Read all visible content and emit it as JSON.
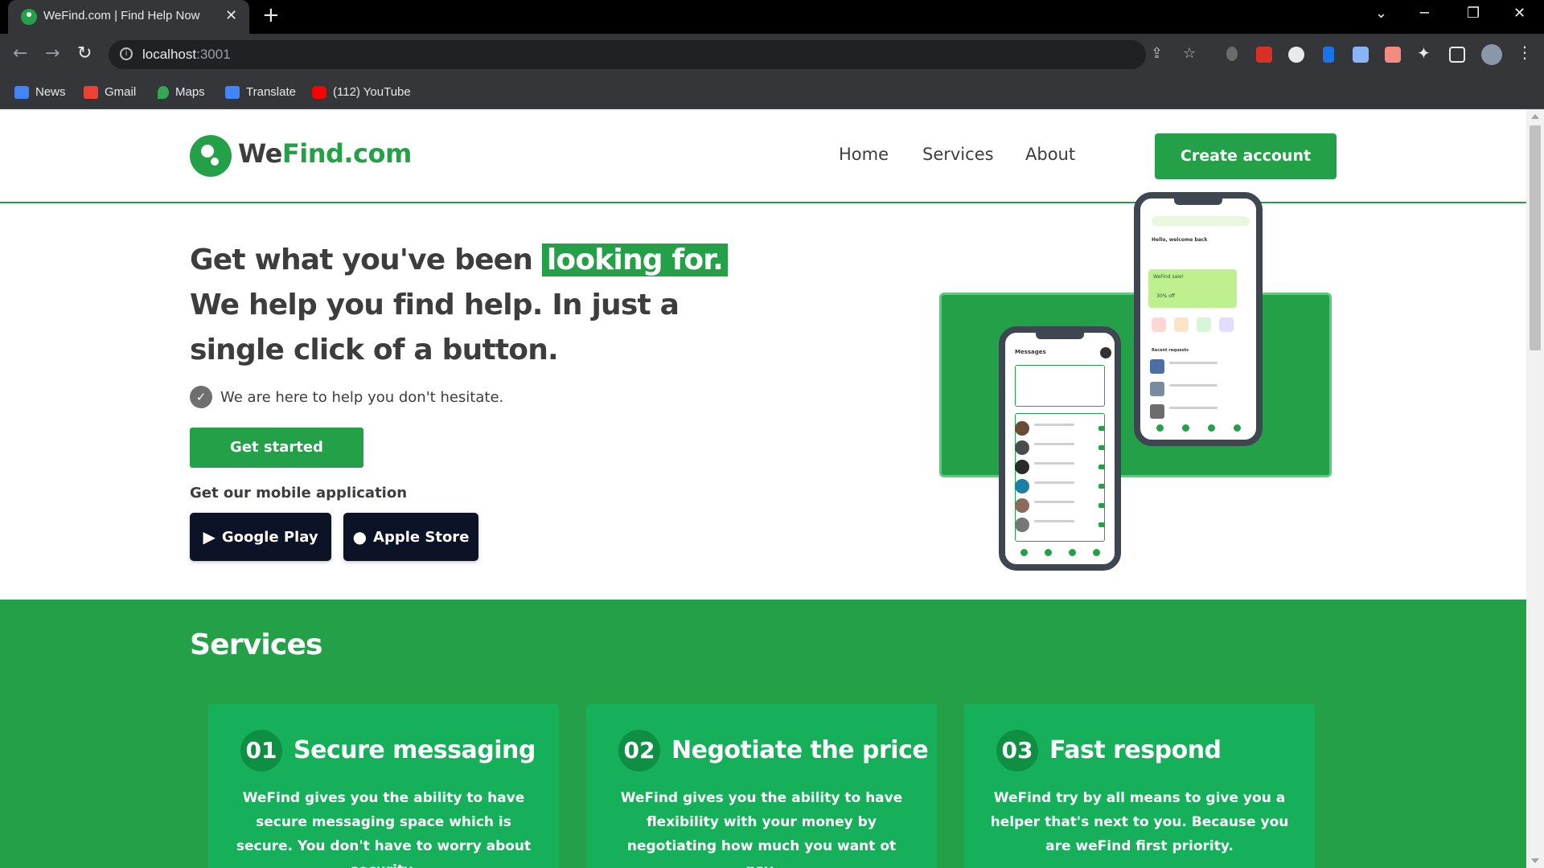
{
  "browser": {
    "tab_title": "WeFind.com | Find Help Now",
    "url_host": "localhost",
    "url_port": ":3001",
    "bookmarks": [
      "News",
      "Gmail",
      "Maps",
      "Translate",
      "(112) YouTube"
    ]
  },
  "header": {
    "logo_we": "We",
    "logo_find": "Find.com",
    "nav": [
      "Home",
      "Services",
      "About"
    ],
    "cta": "Create account"
  },
  "hero": {
    "title_before": "Get what you've been ",
    "title_highlight": "looking for.",
    "title_after": " We help you find help. In just a single click of a button.",
    "tagline": "We are here to help you don't hesitate.",
    "get_started": "Get started",
    "app_label": "Get our mobile application",
    "google_play": "Google Play",
    "apple_store": "Apple Store"
  },
  "phones": {
    "left_title": "Messages",
    "right_title": "Hello, welcome back",
    "promo_title": "WeFind sale!",
    "promo_off": "30% off",
    "recent": "Recent requests"
  },
  "services": {
    "title": "Services",
    "cards": [
      {
        "num": "01",
        "title": "Secure messaging",
        "desc": "WeFind gives you the ability to have secure messaging space which is secure. You don't have to worry about security."
      },
      {
        "num": "02",
        "title": "Negotiate the price",
        "desc": "WeFind gives you the ability to have flexibility with your money by negotiating how much you want ot pay."
      },
      {
        "num": "03",
        "title": "Fast respond",
        "desc": "WeFind try by all means to give you a helper that's next to you. Because you are weFind first priority."
      }
    ]
  },
  "colors": {
    "brand": "#24a148",
    "card": "#16b05a",
    "dark_button": "#0d1326"
  }
}
